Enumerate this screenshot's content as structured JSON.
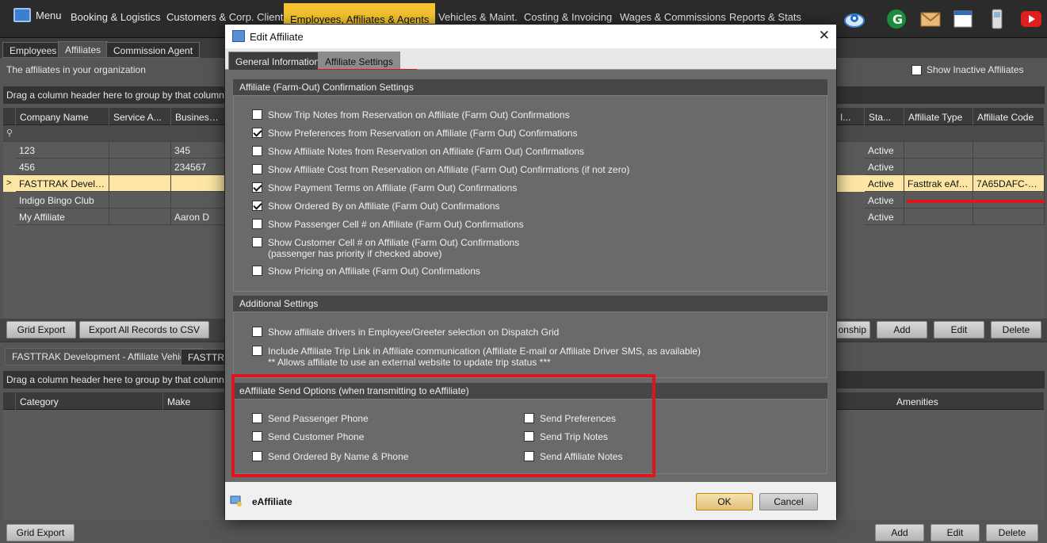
{
  "nav": {
    "menu_label": "Menu",
    "items": [
      "Booking & Logistics",
      "Customers & Corp. Clients",
      "Employees, Affiliates & Agents",
      "Vehicles & Maint.",
      "Costing & Invoicing",
      "Wages & Commissions",
      "Reports & Stats"
    ]
  },
  "subtabs": [
    "Employees",
    "Affiliates",
    "Commission Agent"
  ],
  "affiliates": {
    "info": "The affiliates in your organization",
    "show_inactive_label": "Show Inactive Affiliates",
    "group_hint": "Drag a column header here to group by that column",
    "columns_left": [
      "Company Name",
      "Service A...",
      "Business Ow..."
    ],
    "columns_right": [
      "I...",
      "Sta...",
      "Affiliate Type",
      "Affiliate Code"
    ],
    "rows": [
      {
        "company": "123",
        "service": "",
        "owner": "345",
        "status": "Active",
        "type": "",
        "code": ""
      },
      {
        "company": "456",
        "service": "",
        "owner": "234567",
        "status": "Active",
        "type": "",
        "code": ""
      },
      {
        "company": "FASTTRAK Develop...",
        "service": "",
        "owner": "",
        "status": "Active",
        "type": "Fasttrak eAffil...",
        "code": "7A65DAFC-77..."
      },
      {
        "company": "Indigo Bingo Club",
        "service": "",
        "owner": "",
        "status": "Active",
        "type": "",
        "code": ""
      },
      {
        "company": "My Affiliate",
        "service": "",
        "owner": "Aaron D",
        "status": "Active",
        "type": "",
        "code": ""
      }
    ],
    "buttons_left": [
      "Grid Export",
      "Export All Records to CSV"
    ],
    "buttons_right": [
      "onship",
      "Add",
      "Edit",
      "Delete"
    ]
  },
  "vehicles": {
    "tabs": [
      "FASTTRAK Development - Affiliate Vehicles",
      "FASTTRA"
    ],
    "group_hint": "Drag a column header here to group by that column",
    "columns_left": [
      "Category",
      "Make"
    ],
    "columns_right": [
      "Amenities"
    ],
    "buttons_left": [
      "Grid Export"
    ],
    "buttons_right": [
      "Add",
      "Edit",
      "Delete"
    ]
  },
  "dialog": {
    "title": "Edit Affiliate",
    "close_glyph": "✕",
    "tabs": [
      "General Information",
      "Affiliate Settings"
    ],
    "sections": {
      "confirm": {
        "heading": "Affiliate (Farm-Out) Confirmation Settings",
        "options": [
          {
            "label": "Show Trip Notes from Reservation on Affiliate (Farm Out) Confirmations",
            "sub": "",
            "checked": false
          },
          {
            "label": "Show Preferences from Reservation on Affiliate (Farm Out) Confirmations",
            "sub": "",
            "checked": true
          },
          {
            "label": "Show Affiliate Notes from Reservation on Affiliate (Farm Out) Confirmations",
            "sub": "",
            "checked": false
          },
          {
            "label": "Show Affiliate Cost from Reservation on Affiliate (Farm Out) Confirmations (if not zero)",
            "sub": "",
            "checked": false
          },
          {
            "label": "Show Payment Terms on Affiliate (Farm Out) Confirmations",
            "sub": "",
            "checked": true
          },
          {
            "label": "Show Ordered By on Affiliate (Farm Out) Confirmations",
            "sub": "",
            "checked": true
          },
          {
            "label": "Show Passenger Cell # on Affiliate (Farm Out) Confirmations",
            "sub": "",
            "checked": false
          },
          {
            "label": "Show Customer Cell # on Affiliate (Farm Out) Confirmations",
            "sub": "(passenger has priority if checked above)",
            "checked": false
          },
          {
            "label": "Show Pricing on Affiliate (Farm Out) Confirmations",
            "sub": "",
            "checked": false
          }
        ]
      },
      "additional": {
        "heading": "Additional Settings",
        "options": [
          {
            "label": "Show affiliate drivers in Employee/Greeter selection on Dispatch Grid",
            "sub": "",
            "checked": false
          },
          {
            "label": "Include Affiliate Trip Link in Affiliate communication (Affiliate E-mail or Affiliate Driver SMS, as available)",
            "sub": "** Allows affiliate to use an external website to update trip status ***",
            "checked": false
          }
        ]
      },
      "eaffiliate": {
        "heading": "eAffiliate Send Options (when transmitting to eAffiliate)",
        "options_left": [
          {
            "label": "Send Passenger Phone",
            "checked": false
          },
          {
            "label": "Send Customer Phone",
            "checked": false
          },
          {
            "label": "Send Ordered By Name & Phone",
            "checked": false
          }
        ],
        "options_right": [
          {
            "label": "Send Preferences",
            "checked": false
          },
          {
            "label": "Send Trip Notes",
            "checked": false
          },
          {
            "label": "Send Affiliate Notes",
            "checked": false
          }
        ]
      }
    },
    "footer": {
      "brand": "eAffiliate",
      "ok": "OK",
      "cancel": "Cancel"
    }
  },
  "colors": {
    "accent": "#f4c431",
    "highlight": "#e0141b",
    "selected_row": "#fde6a4"
  }
}
